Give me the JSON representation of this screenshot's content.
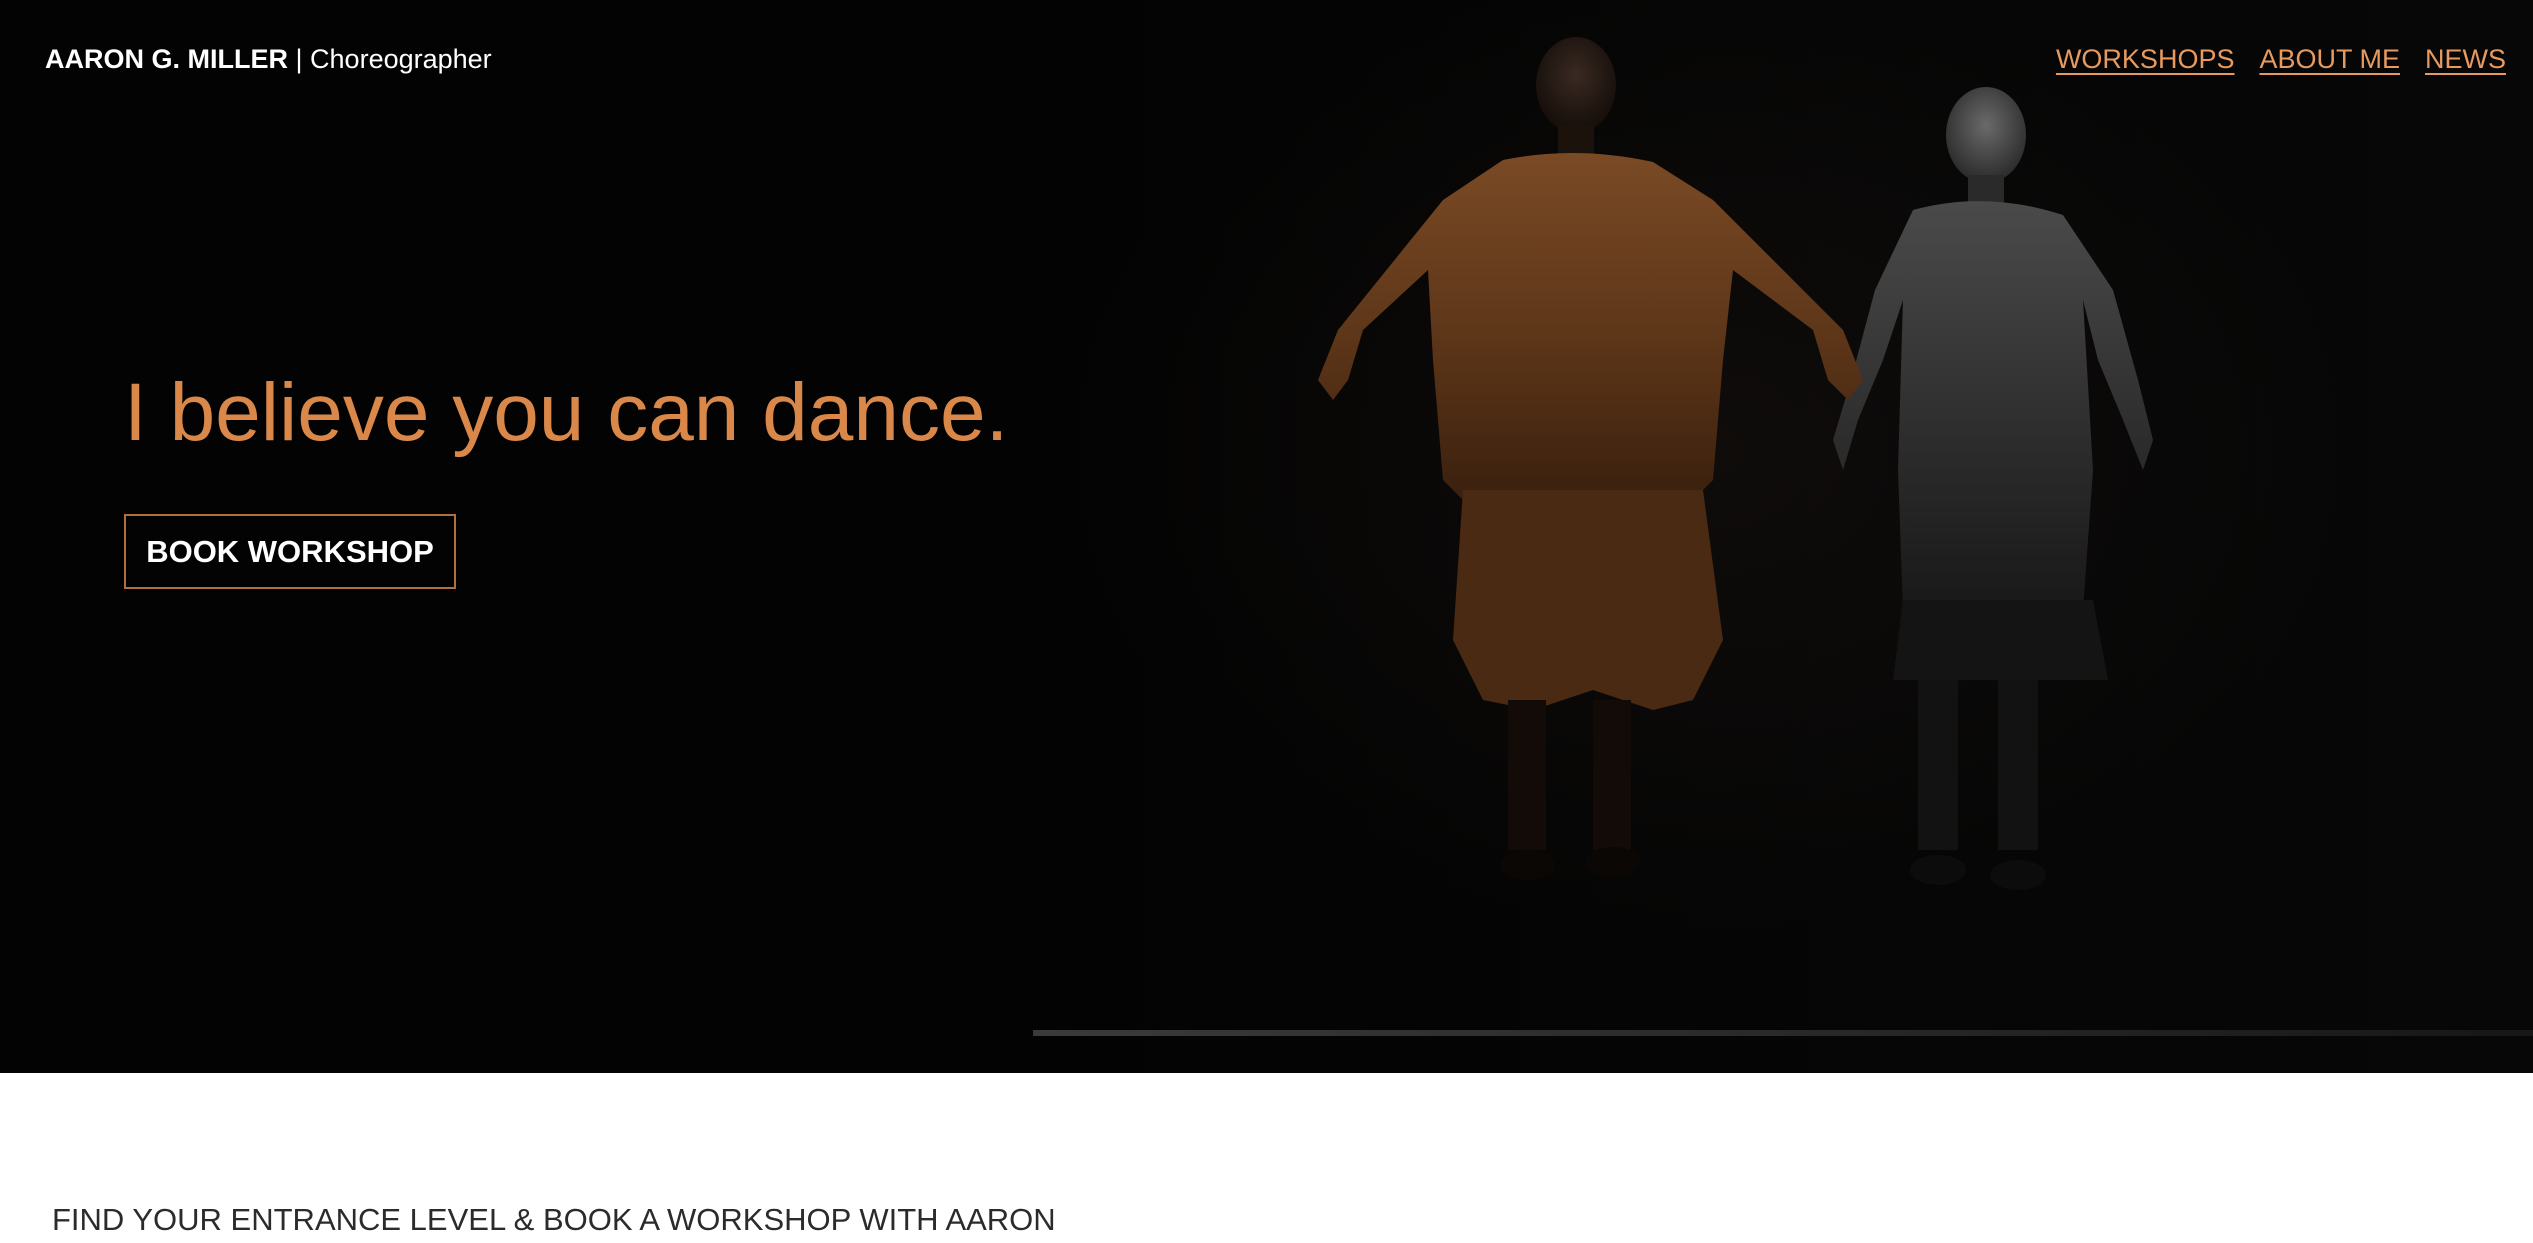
{
  "header": {
    "brand_name": "AARON G. MILLER",
    "brand_separator": "|",
    "brand_role": "Choreographer"
  },
  "nav": {
    "items": [
      {
        "label": "WORKSHOPS"
      },
      {
        "label": "ABOUT ME"
      },
      {
        "label": "NEWS"
      }
    ]
  },
  "hero": {
    "headline": "I believe you can dance.",
    "cta_label": "BOOK WORKSHOP"
  },
  "section": {
    "heading": "FIND YOUR ENTRANCE LEVEL & BOOK A WORKSHOP WITH AARON"
  },
  "colors": {
    "accent": "#d9884a",
    "nav_link": "#e79a5f",
    "hero_background": "#030303",
    "button_border": "#b36e3d"
  }
}
